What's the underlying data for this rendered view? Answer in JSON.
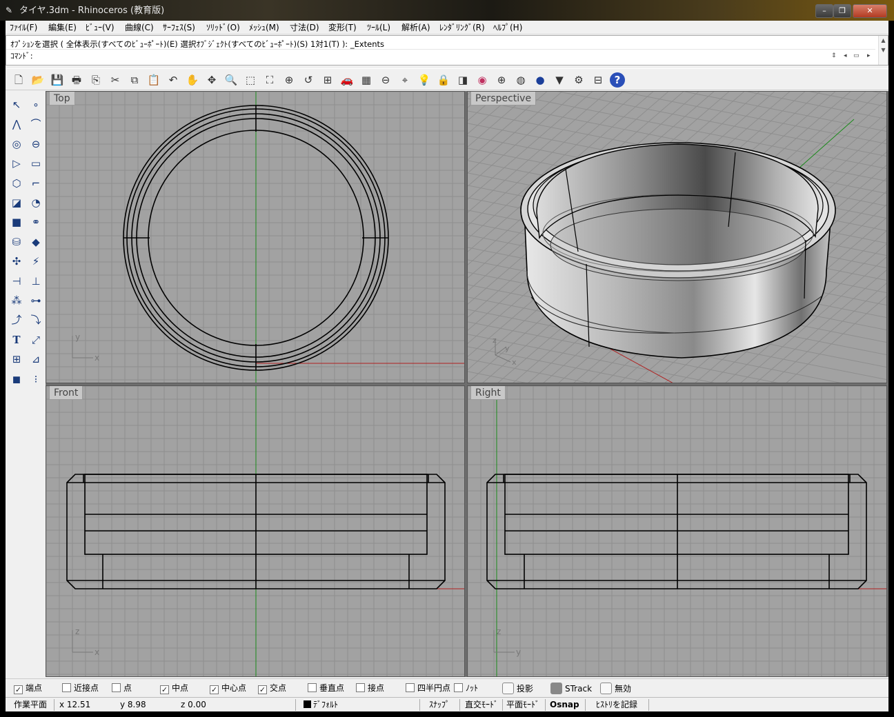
{
  "window": {
    "title": "タイヤ.3dm - Rhinoceros (教育版)",
    "min": "–",
    "max": "❐",
    "close": "✕"
  },
  "menu": [
    "ﾌｧｲﾙ(F)",
    "編集(E)",
    "ﾋﾞｭｰ(V)",
    "曲線(C)",
    "ｻｰﾌｪｽ(S)",
    "ｿﾘｯﾄﾞ(O)",
    "ﾒｯｼｭ(M)",
    "寸法(D)",
    "変形(T)",
    "ﾂｰﾙ(L)",
    "解析(A)",
    "ﾚﾝﾀﾞﾘﾝｸﾞ(R)",
    "ﾍﾙﾌﾟ(H)"
  ],
  "command": {
    "history": "ｵﾌﾟｼｮﾝを選択 ( 全体表示(すべてのﾋﾞｭｰﾎﾟｰﾄ)(E) 選択ｵﾌﾞｼﾞｪｸﾄ(すべてのﾋﾞｭｰﾎﾟｰﾄ)(S) 1対1(T) ): _Extents",
    "prompt": "ｺﾏﾝﾄﾞ:"
  },
  "toolbar_icons": [
    "new-file-icon",
    "open-file-icon",
    "save-icon",
    "print-icon",
    "import-icon",
    "cut-icon",
    "copy-icon",
    "paste-icon",
    "undo-icon",
    "pan-icon",
    "rotate-view-icon",
    "zoom-icon",
    "zoom-window-icon",
    "zoom-extents-icon",
    "zoom-selected-icon",
    "undo-view-icon",
    "four-viewports-icon",
    "car-icon",
    "grid-icon",
    "cplane-icon",
    "osnap-icon",
    "light-icon",
    "lock-icon",
    "layer-icon",
    "color-icon",
    "wireframe-icon",
    "shaded-icon",
    "render-icon",
    "spotlight-icon",
    "options-icon",
    "properties-icon",
    "help-icon"
  ],
  "left_tools": [
    "select-icon",
    "point-icon",
    "polyline-icon",
    "curve-icon",
    "circle-icon",
    "ellipse-icon",
    "arc-icon",
    "rectangle-icon",
    "polygon-icon",
    "fillet-icon",
    "surface-icon",
    "surface-edit-icon",
    "box-icon",
    "boolean-icon",
    "cylinder-icon",
    "plane-icon",
    "gear-icon",
    "explode-icon",
    "trim-icon",
    "split-icon",
    "group-icon",
    "dimension-icon",
    "curve-edit-icon",
    "blend-icon",
    "text-icon",
    "transform-icon",
    "array-icon",
    "analyze-icon",
    "render-solid-icon",
    "mesh-icon"
  ],
  "viewports": {
    "top": "Top",
    "perspective": "Perspective",
    "front": "Front",
    "right": "Right"
  },
  "axes": {
    "top": [
      "y",
      "x"
    ],
    "persp": [
      "z",
      "y",
      "x"
    ],
    "front": [
      "z",
      "x"
    ],
    "right": [
      "z",
      "y"
    ]
  },
  "osnaps": [
    {
      "label": "端点",
      "checked": "✓"
    },
    {
      "label": "近接点",
      "checked": ""
    },
    {
      "label": "点",
      "checked": ""
    },
    {
      "label": "中点",
      "checked": "✓"
    },
    {
      "label": "中心点",
      "checked": "✓"
    },
    {
      "label": "交点",
      "checked": "✓"
    },
    {
      "label": "垂直点",
      "checked": ""
    },
    {
      "label": "接点",
      "checked": ""
    },
    {
      "label": "四半円点",
      "checked": ""
    },
    {
      "label": "ﾉｯﾄ",
      "checked": ""
    }
  ],
  "toggles": {
    "project": "投影",
    "strack": "STrack",
    "disable": "無効"
  },
  "status": {
    "cplane": "作業平面",
    "x": "x 12.51",
    "y": "y 8.98",
    "z": "z 0.00",
    "layer": "ﾃﾞﾌｫﾙﾄ",
    "snap": "ｽﾅｯﾌﾟ",
    "ortho": "直交ﾓｰﾄﾞ",
    "planar": "平面ﾓｰﾄﾞ",
    "osnap": "Osnap",
    "history": "ﾋｽﾄﾘを記録"
  },
  "colors": {
    "grid_bg": "#a2a2a2",
    "x_axis": "#b02020",
    "y_axis": "#1a8a1a"
  }
}
